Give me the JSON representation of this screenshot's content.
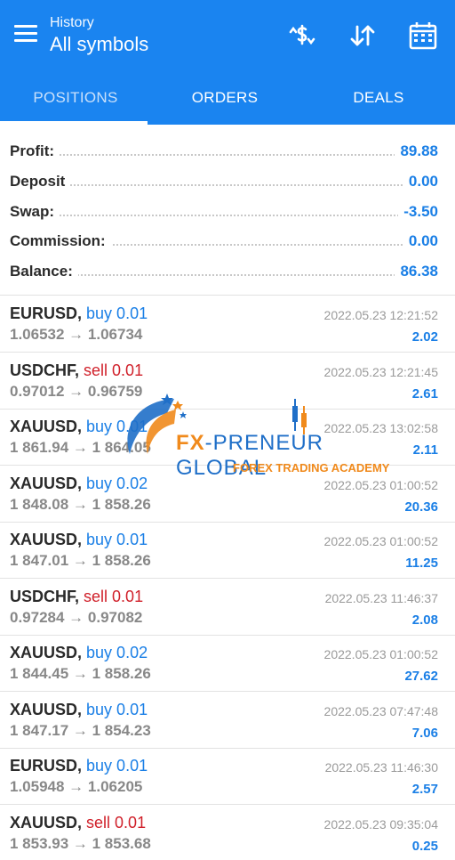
{
  "header": {
    "subtitle": "History",
    "title": "All symbols",
    "icons": [
      "menu-icon",
      "currency-exchange-icon",
      "sort-icon",
      "calendar-icon"
    ]
  },
  "tabs": [
    {
      "label": "POSITIONS",
      "active": true
    },
    {
      "label": "ORDERS",
      "active": false
    },
    {
      "label": "DEALS",
      "active": false
    }
  ],
  "summary": [
    {
      "label": "Profit:",
      "value": "89.88"
    },
    {
      "label": "Deposit",
      "value": "0.00"
    },
    {
      "label": "Swap:",
      "value": "-3.50"
    },
    {
      "label": "Commission:",
      "value": "0.00"
    },
    {
      "label": "Balance:",
      "value": "86.38"
    }
  ],
  "trades": [
    {
      "symbol": "EURUSD,",
      "side": "buy 0.01",
      "type": "buy",
      "prices": "1.06532 → 1.06734",
      "time": "2022.05.23 12:21:52",
      "profit": "2.02"
    },
    {
      "symbol": "USDCHF,",
      "side": "sell 0.01",
      "type": "sell",
      "prices": "0.97012 → 0.96759",
      "time": "2022.05.23 12:21:45",
      "profit": "2.61"
    },
    {
      "symbol": "XAUUSD,",
      "side": "buy 0.01",
      "type": "buy",
      "prices": "1 861.94 → 1 864.05",
      "time": "2022.05.23 13:02:58",
      "profit": "2.11"
    },
    {
      "symbol": "XAUUSD,",
      "side": "buy 0.02",
      "type": "buy",
      "prices": "1 848.08 → 1 858.26",
      "time": "2022.05.23 01:00:52",
      "profit": "20.36"
    },
    {
      "symbol": "XAUUSD,",
      "side": "buy 0.01",
      "type": "buy",
      "prices": "1 847.01 → 1 858.26",
      "time": "2022.05.23 01:00:52",
      "profit": "11.25"
    },
    {
      "symbol": "USDCHF,",
      "side": "sell 0.01",
      "type": "sell",
      "prices": "0.97284 → 0.97082",
      "time": "2022.05.23 11:46:37",
      "profit": "2.08"
    },
    {
      "symbol": "XAUUSD,",
      "side": "buy 0.02",
      "type": "buy",
      "prices": "1 844.45 → 1 858.26",
      "time": "2022.05.23 01:00:52",
      "profit": "27.62"
    },
    {
      "symbol": "XAUUSD,",
      "side": "buy 0.01",
      "type": "buy",
      "prices": "1 847.17 → 1 854.23",
      "time": "2022.05.23 07:47:48",
      "profit": "7.06"
    },
    {
      "symbol": "EURUSD,",
      "side": "buy 0.01",
      "type": "buy",
      "prices": "1.05948 → 1.06205",
      "time": "2022.05.23 11:46:30",
      "profit": "2.57"
    },
    {
      "symbol": "XAUUSD,",
      "side": "sell 0.01",
      "type": "sell",
      "prices": "1 853.93 → 1 853.68",
      "time": "2022.05.23 09:35:04",
      "profit": "0.25"
    }
  ],
  "watermark": {
    "brand_prefix": "FX",
    "brand_rest": "-PRENEUR GLOBAL",
    "tagline": "FOREX TRADING ACADEMY"
  },
  "colors": {
    "header": "#1a84f0",
    "value_blue": "#1a7fe6",
    "sell_red": "#d0202a",
    "brand_orange": "#f08a1c"
  }
}
